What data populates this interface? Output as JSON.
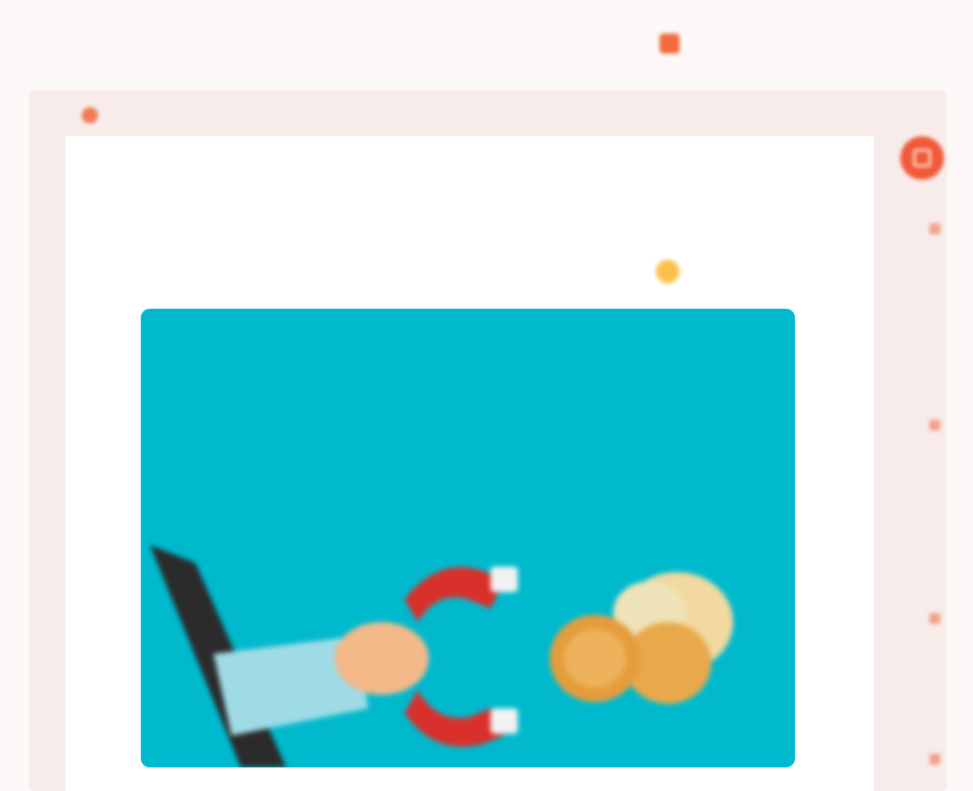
{
  "brand": {
    "logo_text": "",
    "icon": "logo-icon",
    "color": "#f26a3d"
  },
  "breadcrumb": {
    "text": "",
    "icon": "home-icon"
  },
  "article": {
    "title": "",
    "date": "",
    "date_icon": "clock-icon",
    "hero_icon": "magnet-attracting-coins-illustration"
  },
  "sidebar": {
    "share_icon": "share-icon",
    "links": [
      "side-link-1",
      "side-link-2",
      "side-link-3",
      "side-link-4"
    ]
  },
  "colors": {
    "accent": "#f26a3d",
    "hero_background": "#00b9cd",
    "page_background": "#fbf8f7",
    "frame_background": "#f7ecea"
  }
}
